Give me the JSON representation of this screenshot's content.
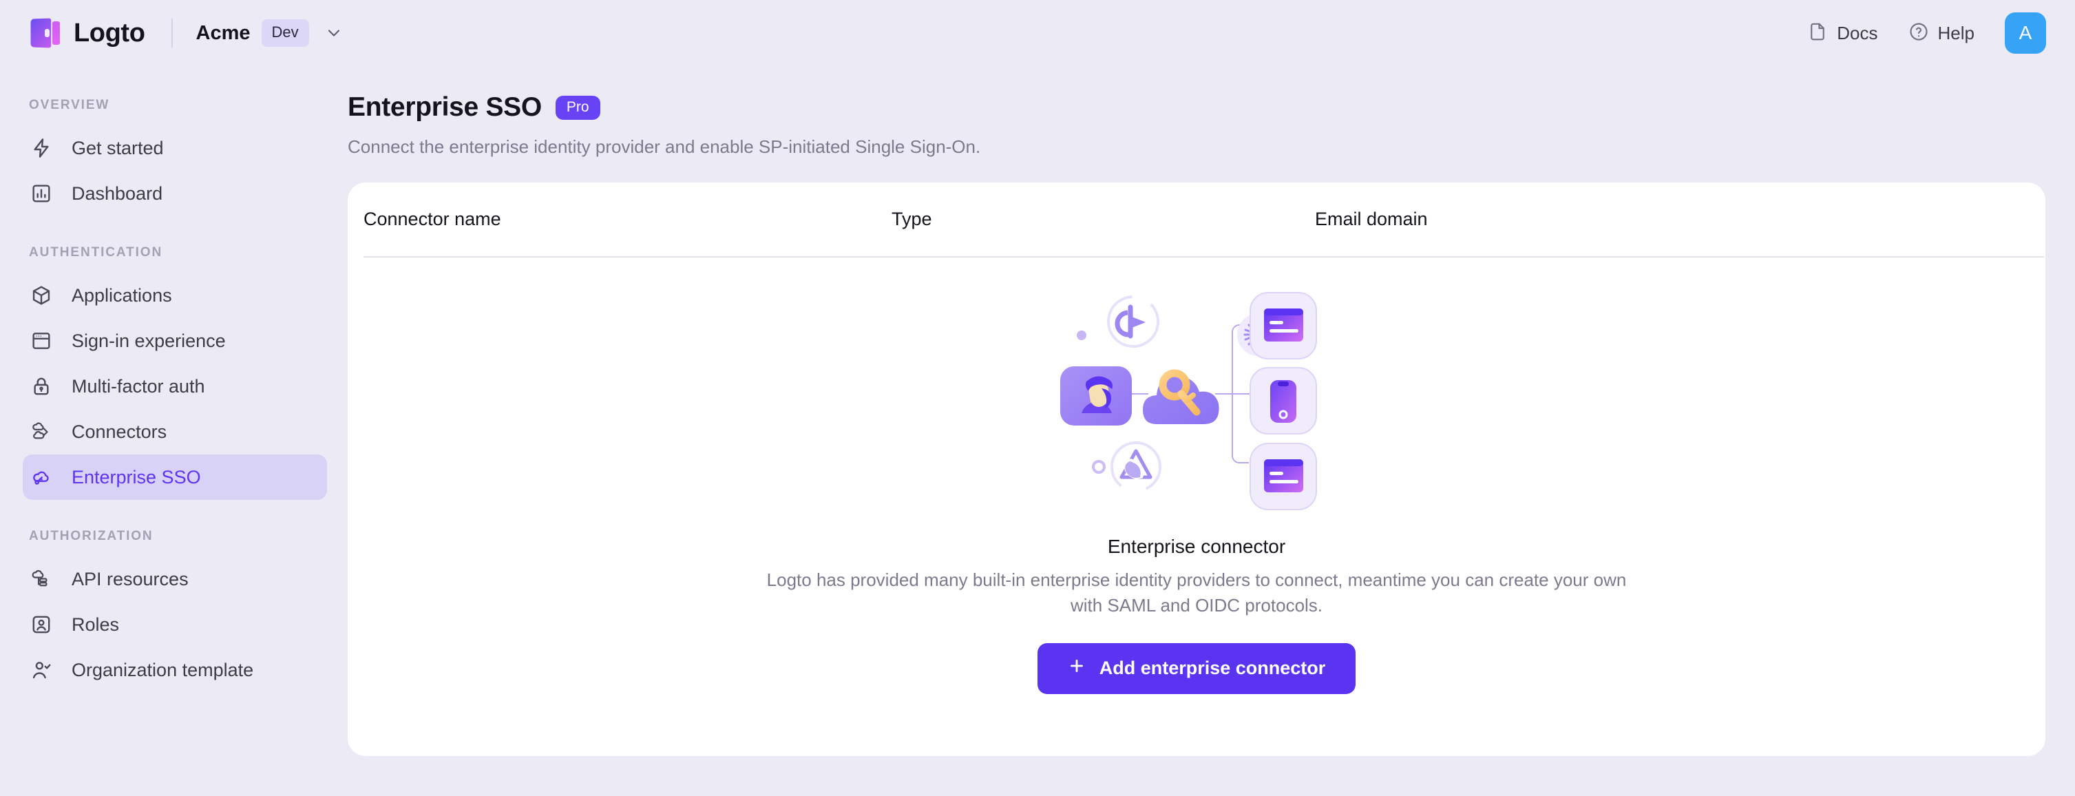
{
  "topbar": {
    "brand_name": "Logto",
    "logo_icon": "logto-door-logo",
    "tenant_name": "Acme",
    "tenant_badge": "Dev",
    "chevron_icon": "chevron-down-icon",
    "docs_label": "Docs",
    "docs_icon": "document-icon",
    "help_label": "Help",
    "help_icon": "question-circle-icon",
    "avatar_initial": "A",
    "avatar_color": "#36a3f7"
  },
  "sidebar": {
    "sections": [
      {
        "label": "OVERVIEW",
        "items": [
          {
            "label": "Get started",
            "icon": "lightning-bolt-icon",
            "active": false
          },
          {
            "label": "Dashboard",
            "icon": "bar-chart-icon",
            "active": false
          }
        ]
      },
      {
        "label": "AUTHENTICATION",
        "items": [
          {
            "label": "Applications",
            "icon": "cube-icon",
            "active": false
          },
          {
            "label": "Sign-in experience",
            "icon": "browser-window-icon",
            "active": false
          },
          {
            "label": "Multi-factor auth",
            "icon": "lock-icon",
            "active": false
          },
          {
            "label": "Connectors",
            "icon": "connector-clouds-icon",
            "active": false
          },
          {
            "label": "Enterprise SSO",
            "icon": "cloud-key-icon",
            "active": true
          }
        ]
      },
      {
        "label": "AUTHORIZATION",
        "items": [
          {
            "label": "API resources",
            "icon": "cloud-server-icon",
            "active": false
          },
          {
            "label": "Roles",
            "icon": "user-badge-icon",
            "active": false
          },
          {
            "label": "Organization template",
            "icon": "user-check-icon",
            "active": false
          }
        ]
      }
    ],
    "active_bg": "#d8d2f7",
    "active_fg": "#5d34f2"
  },
  "page": {
    "title": "Enterprise SSO",
    "badge": "Pro",
    "badge_color": "#6843f5",
    "subtitle": "Connect the enterprise identity provider and enable SP-initiated Single Sign-On."
  },
  "table": {
    "columns": [
      "Connector name",
      "Type",
      "Email domain"
    ],
    "rows": []
  },
  "empty_state": {
    "illustration": "enterprise-connector-illustration",
    "title": "Enterprise connector",
    "description": "Logto has provided many built-in enterprise identity providers to connect, meantime you can create your own with SAML and OIDC protocols.",
    "button_label": "Add enterprise connector",
    "button_icon": "plus-icon",
    "button_color": "#5b34f2"
  }
}
